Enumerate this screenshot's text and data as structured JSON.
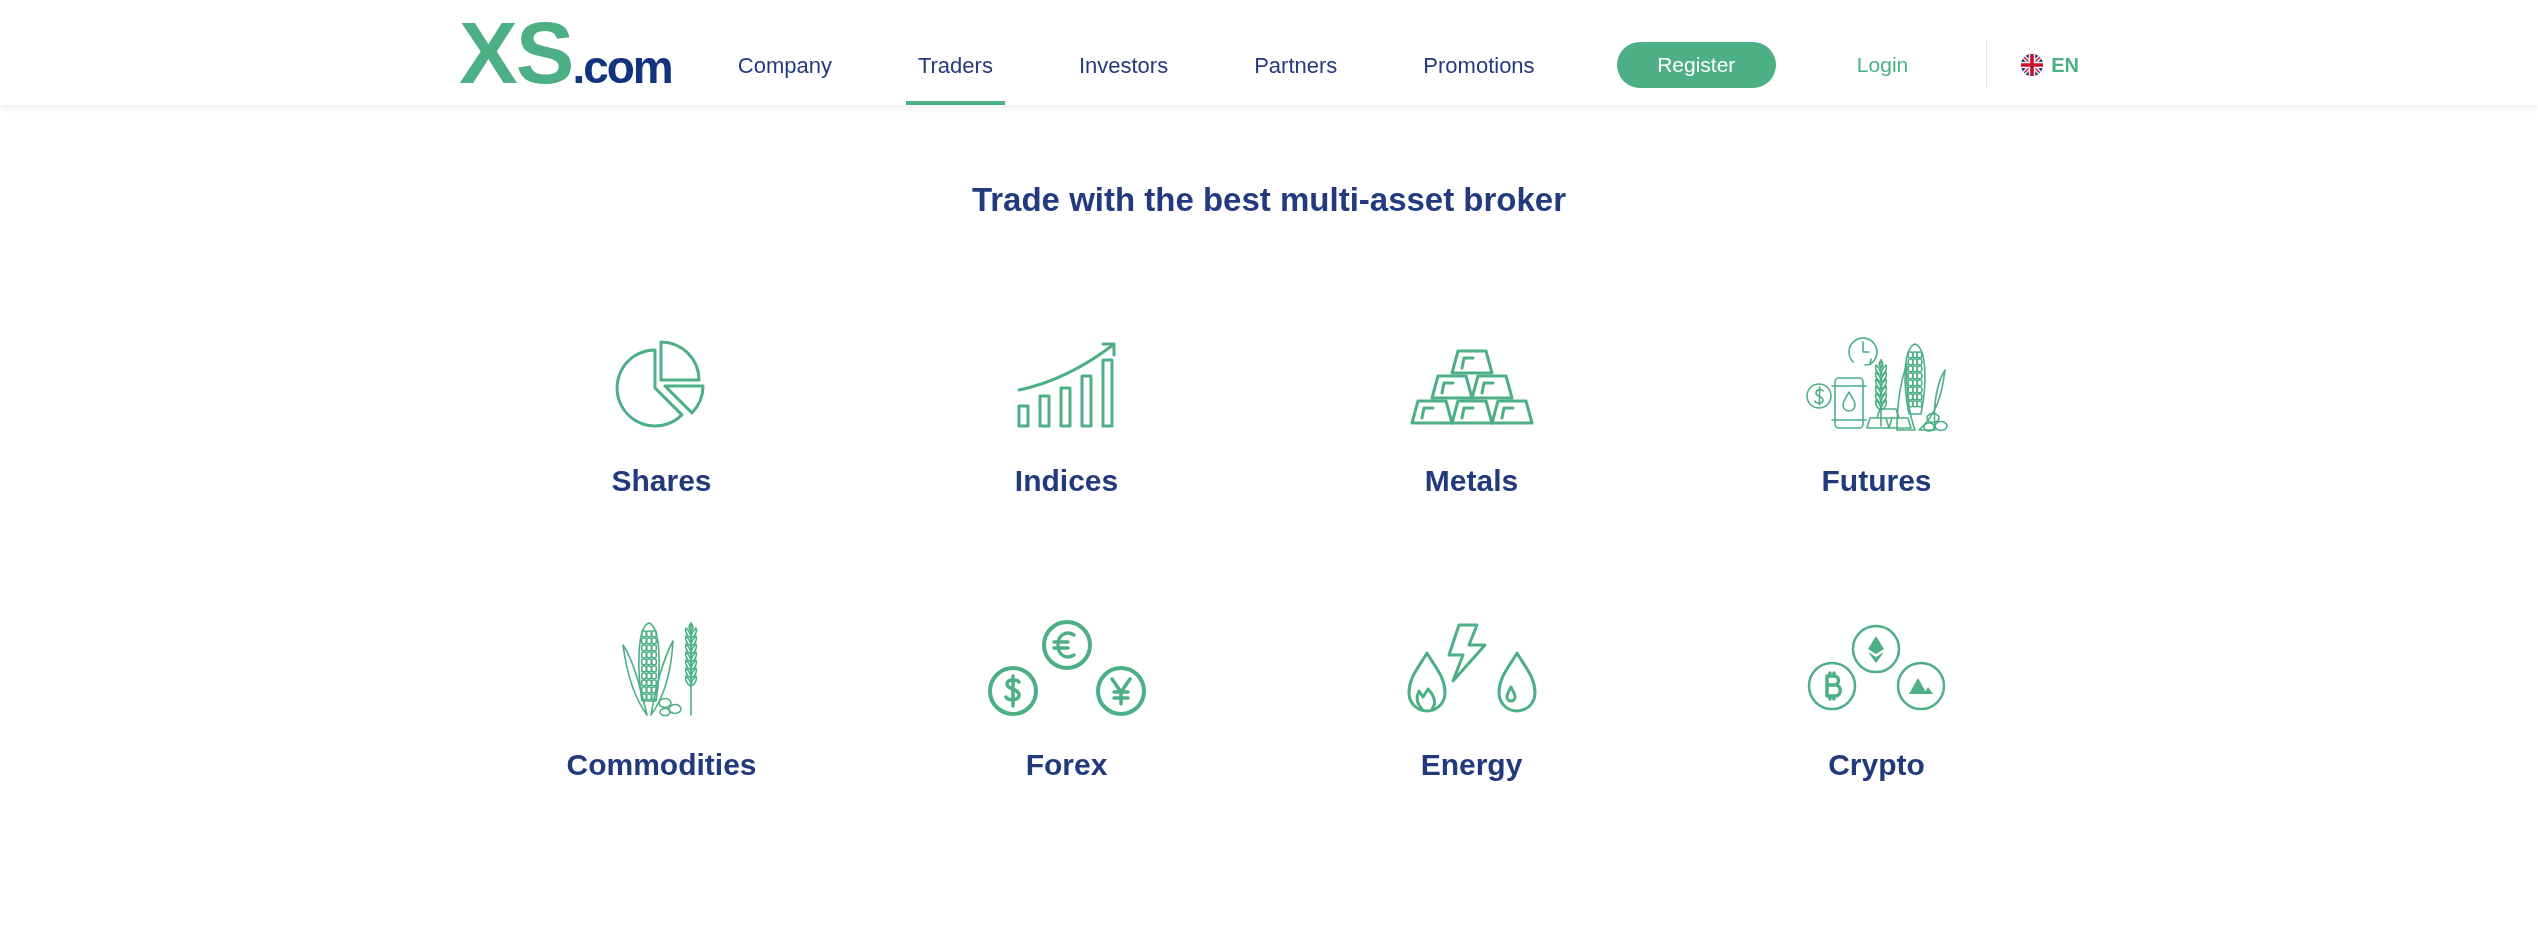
{
  "header": {
    "logo": {
      "mark": "XS",
      "domain": ".com"
    },
    "nav": [
      {
        "label": "Company",
        "selected": false
      },
      {
        "label": "Traders",
        "selected": true
      },
      {
        "label": "Investors",
        "selected": false
      },
      {
        "label": "Partners",
        "selected": false
      },
      {
        "label": "Promotions",
        "selected": false
      }
    ],
    "register_button": "Register",
    "login_link": "Login",
    "language": "EN"
  },
  "heading": "Trade with the best multi-asset broker",
  "categories": [
    {
      "label": "Shares",
      "kind": "pie"
    },
    {
      "label": "Indices",
      "kind": "bars"
    },
    {
      "label": "Metals",
      "kind": "metals"
    },
    {
      "label": "Futures",
      "kind": "futures"
    },
    {
      "label": "Commodities",
      "kind": "crops"
    },
    {
      "label": "Forex",
      "kind": "forex"
    },
    {
      "label": "Energy",
      "kind": "energy"
    },
    {
      "label": "Crypto",
      "kind": "crypto"
    }
  ]
}
